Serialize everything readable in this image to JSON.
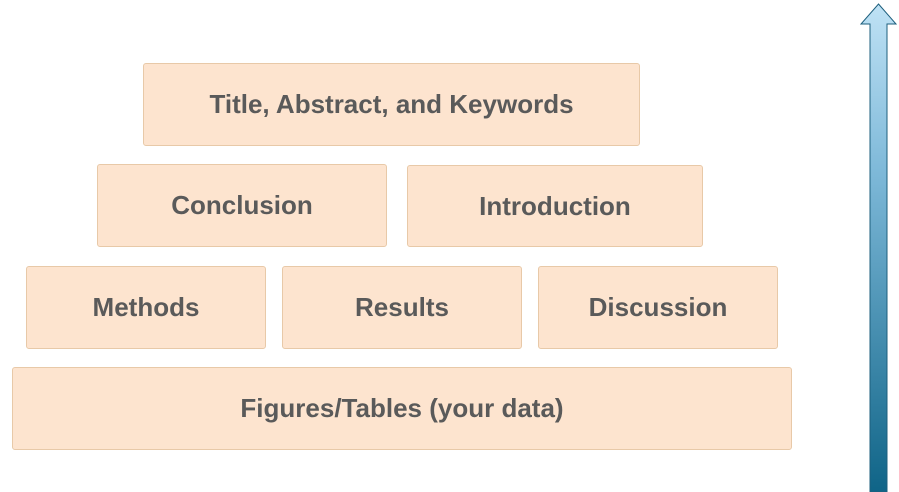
{
  "pyramid": {
    "top": {
      "title_block": "Title, Abstract, and Keywords"
    },
    "second_row": {
      "conclusion": "Conclusion",
      "introduction": "Introduction"
    },
    "third_row": {
      "methods": "Methods",
      "results": "Results",
      "discussion": "Discussion"
    },
    "base": {
      "figures_tables": "Figures/Tables (your data)"
    }
  },
  "colors": {
    "block_fill": "#fde4cf",
    "block_border": "#e8c9a8",
    "text": "#5a5a5a",
    "arrow_top": "#bfe2f5",
    "arrow_bottom": "#0f6487"
  },
  "arrow": {
    "direction": "up"
  }
}
